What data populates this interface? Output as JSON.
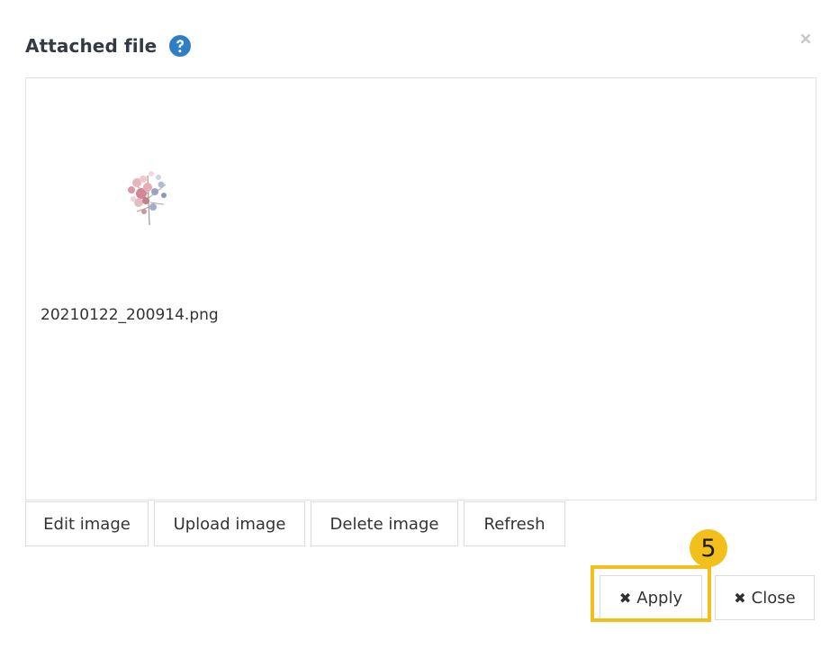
{
  "dialog": {
    "title": "Attached file",
    "help_icon": "question-circle-icon",
    "close_icon": "close-icon"
  },
  "file": {
    "name": "20210122_200914.png",
    "thumbnail_icon": "flower-image-thumbnail"
  },
  "toolbar": {
    "edit_label": "Edit image",
    "upload_label": "Upload image",
    "delete_label": "Delete image",
    "refresh_label": "Refresh"
  },
  "footer": {
    "apply_label": "Apply",
    "close_label": "Close",
    "apply_icon": "close-icon",
    "close_icon": "close-icon"
  },
  "annotation": {
    "step_number": "5",
    "highlight_color": "#f3bf1a"
  },
  "colors": {
    "accent_blue": "#2f7dc4",
    "border": "#dcdcdc",
    "text": "#333333"
  }
}
